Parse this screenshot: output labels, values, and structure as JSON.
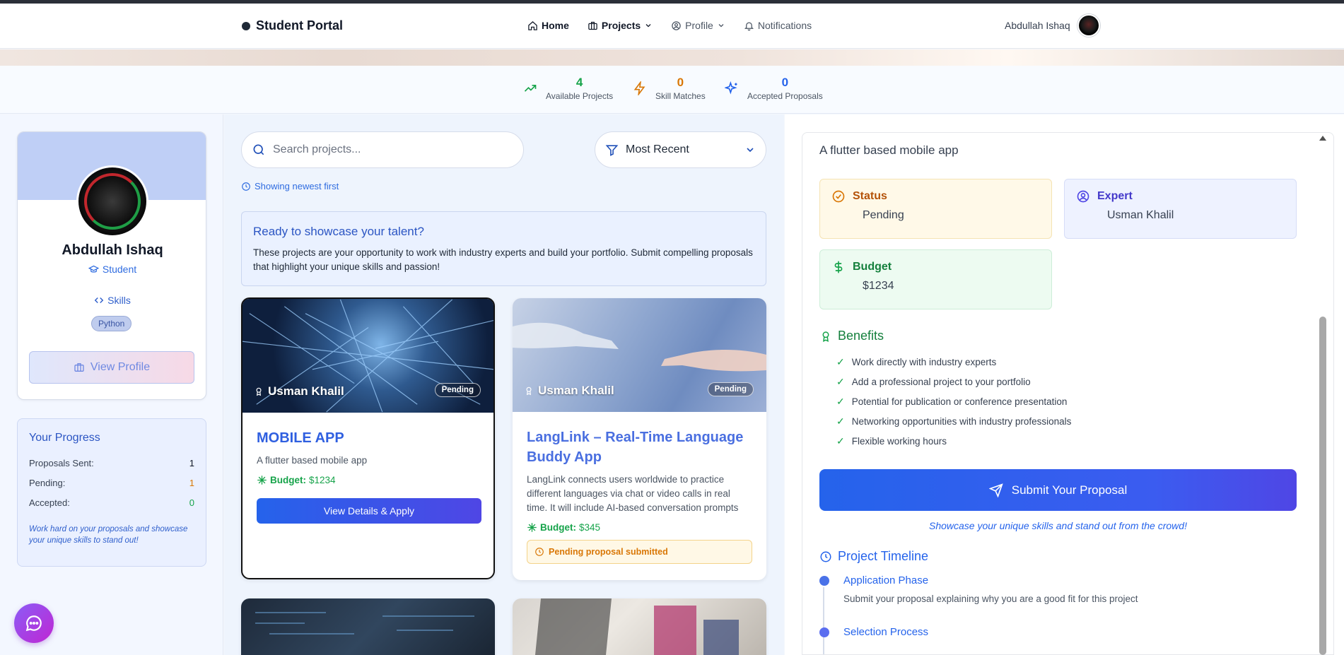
{
  "nav": {
    "brand": "Student Portal",
    "items": [
      {
        "label": "Home",
        "icon": "home-icon"
      },
      {
        "label": "Projects",
        "icon": "briefcase-icon"
      },
      {
        "label": "Profile",
        "icon": "user-circle-icon"
      },
      {
        "label": "Notifications",
        "icon": "bell-icon"
      }
    ],
    "user_name": "Abdullah Ishaq"
  },
  "stats": [
    {
      "value": "4",
      "label": "Available Projects",
      "color": "#16a34a",
      "icon": "trending-up-icon"
    },
    {
      "value": "0",
      "label": "Skill Matches",
      "color": "#d97706",
      "icon": "lightning-icon"
    },
    {
      "value": "0",
      "label": "Accepted Proposals",
      "color": "#2563eb",
      "icon": "sparkles-icon"
    }
  ],
  "profile": {
    "name": "Abdullah Ishaq",
    "role": "Student",
    "skills_label": "Skills",
    "skills": [
      "Python"
    ],
    "view_profile_label": "View Profile"
  },
  "progress": {
    "title": "Your Progress",
    "rows": [
      {
        "label": "Proposals Sent:",
        "value": "1",
        "color": "#111827"
      },
      {
        "label": "Pending:",
        "value": "1",
        "color": "#d97706"
      },
      {
        "label": "Accepted:",
        "value": "0",
        "color": "#16a34a"
      }
    ],
    "note": "Work hard on your proposals and showcase your unique skills to stand out!"
  },
  "search": {
    "placeholder": "Search projects...",
    "sort_value": "Most Recent",
    "sort_note": "Showing newest first"
  },
  "talent": {
    "title": "Ready to showcase your talent?",
    "body": "These projects are your opportunity to work with industry experts and build your portfolio. Submit compelling proposals that highlight your unique skills and passion!"
  },
  "projects": [
    {
      "owner": "Usman Khalil",
      "status": "Pending",
      "title": "MOBILE APP",
      "desc": "A flutter based mobile app",
      "budget_label": "Budget:",
      "budget": "$1234",
      "action": "View Details & Apply"
    },
    {
      "owner": "Usman Khalil",
      "status": "Pending",
      "title": "LangLink – Real-Time Language Buddy App",
      "desc": "LangLink connects users worldwide to practice different languages via chat or video calls in real time. It will include AI-based conversation prompts",
      "budget_label": "Budget:",
      "budget": "$345",
      "pending_note": "Pending proposal submitted"
    }
  ],
  "detail": {
    "description": "A flutter based mobile app",
    "status_label": "Status",
    "status_value": "Pending",
    "expert_label": "Expert",
    "expert_value": "Usman Khalil",
    "budget_label": "Budget",
    "budget_value": "$1234",
    "benefits_title": "Benefits",
    "benefits": [
      "Work directly with industry experts",
      "Add a professional project to your portfolio",
      "Potential for publication or conference presentation",
      "Networking opportunities with industry professionals",
      "Flexible working hours"
    ],
    "submit_label": "Submit Your Proposal",
    "showcase_note": "Showcase your unique skills and stand out from the crowd!",
    "timeline_title": "Project Timeline",
    "timeline": [
      {
        "title": "Application Phase",
        "desc": "Submit your proposal explaining why you are a good fit for this project"
      },
      {
        "title": "Selection Process",
        "desc": ""
      }
    ]
  }
}
